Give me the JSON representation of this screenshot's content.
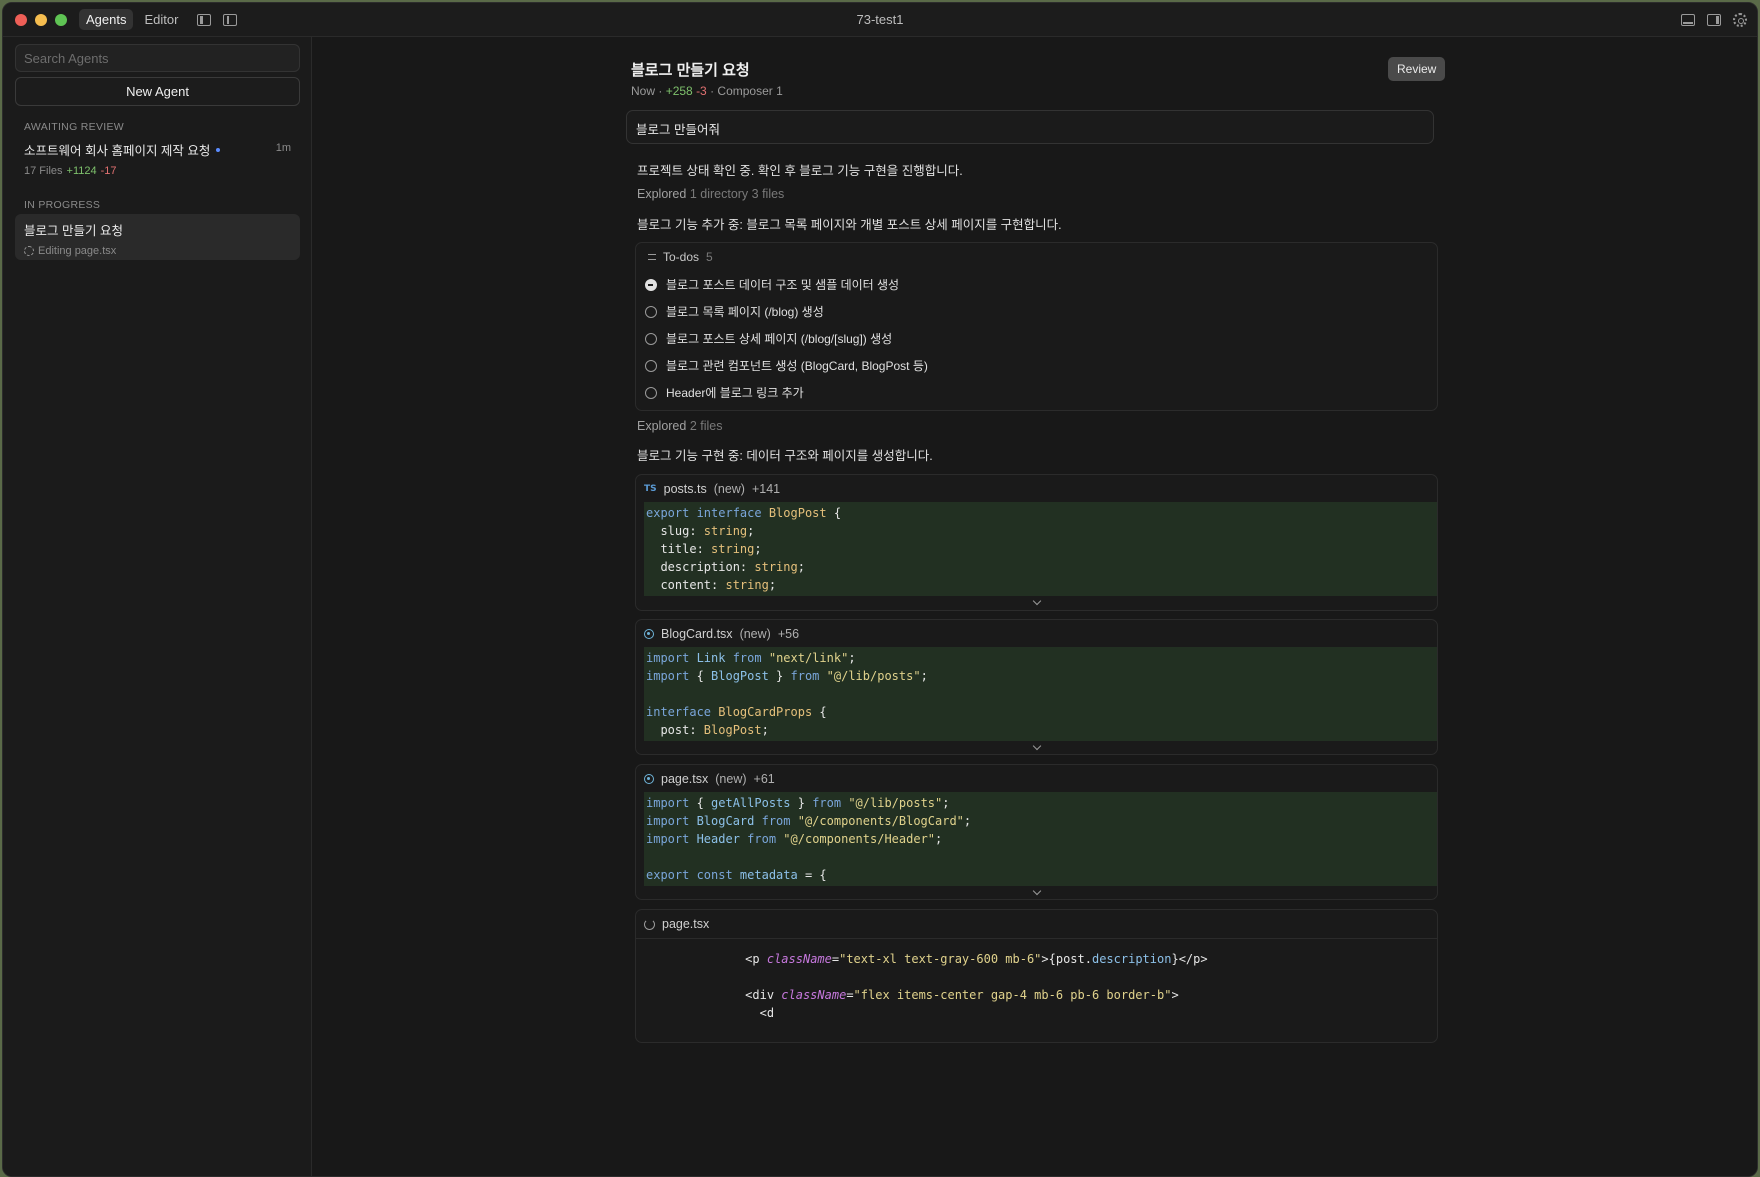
{
  "titlebar": {
    "tabs": [
      "Agents",
      "Editor"
    ],
    "active_tab": "Agents",
    "window_title": "73-test1"
  },
  "sidebar": {
    "search_placeholder": "Search Agents",
    "new_agent_label": "New Agent",
    "sections": {
      "awaiting_review": {
        "label": "AWAITING REVIEW",
        "items": [
          {
            "title": "소프트웨어 회사 홈페이지 제작 요청",
            "time": "1m",
            "files": "17 Files",
            "added": "+1124",
            "removed": "-17"
          }
        ]
      },
      "in_progress": {
        "label": "IN PROGRESS",
        "items": [
          {
            "title": "블로그 만들기 요청",
            "status": "Editing page.tsx"
          }
        ]
      }
    }
  },
  "main": {
    "title": "블로그 만들기 요청",
    "meta": {
      "time": "Now",
      "added": "+258",
      "removed": "-3",
      "model": "Composer 1"
    },
    "review_label": "Review",
    "prompt": "블로그 만들어줘",
    "messages": {
      "m1": "프로젝트 상태 확인 중. 확인 후 블로그 기능 구현을 진행합니다.",
      "explored1_label": "Explored",
      "explored1_detail": "1 directory 3 files",
      "m2": "블로그 기능 추가 중: 블로그 목록 페이지와 개별 포스트 상세 페이지를 구현합니다.",
      "explored2_label": "Explored",
      "explored2_detail": "2 files",
      "m3": "블로그 기능 구현 중: 데이터 구조와 페이지를 생성합니다."
    },
    "todos": {
      "label": "To-dos",
      "count": "5",
      "items": [
        "블로그 포스트 데이터 구조 및 샘플 데이터 생성",
        "블로그 목록 페이지 (/blog) 생성",
        "블로그 포스트 상세 페이지 (/blog/[slug]) 생성",
        "블로그 관련 컴포넌트 생성 (BlogCard, BlogPost 등)",
        "Header에 블로그 링크 추가"
      ]
    },
    "files": [
      {
        "icon": "TS",
        "name": "posts.ts",
        "status": "(new)",
        "diff": "+141"
      },
      {
        "name": "BlogCard.tsx",
        "status": "(new)",
        "diff": "+56"
      },
      {
        "name": "page.tsx",
        "status": "(new)",
        "diff": "+61"
      },
      {
        "name": "page.tsx"
      }
    ],
    "code": {
      "posts": [
        "export interface BlogPost {",
        "  slug: string;",
        "  title: string;",
        "  description: string;",
        "  content: string;"
      ],
      "blogcard": [
        "import Link from \"next/link\";",
        "import { BlogPost } from \"@/lib/posts\";",
        "",
        "interface BlogCardProps {",
        "  post: BlogPost;"
      ],
      "page": [
        "import { getAllPosts } from \"@/lib/posts\";",
        "import BlogCard from \"@/components/BlogCard\";",
        "import Header from \"@/components/Header\";",
        "",
        "export const metadata = {"
      ],
      "editing": [
        "              <p className=\"text-xl text-gray-600 mb-6\">{post.description}</p>",
        "",
        "              <div className=\"flex items-center gap-4 mb-6 pb-6 border-b\">",
        "                <d"
      ]
    }
  }
}
